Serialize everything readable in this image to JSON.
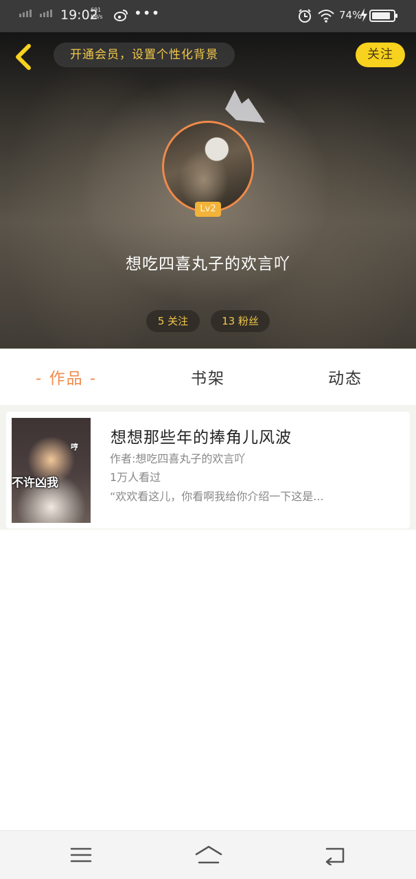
{
  "status_bar": {
    "time": "19:02",
    "net_speed_value": "691",
    "net_speed_unit": "KB/s",
    "more": "•••",
    "battery_percent": "74%"
  },
  "header": {
    "vip_banner": "开通会员，设置个性化背景",
    "follow_button": "关注",
    "level_badge": "Lv2",
    "username": "想吃四喜丸子的欢言吖",
    "following": "5 关注",
    "followers": "13 粉丝"
  },
  "tabs": [
    {
      "label": "- 作品 -",
      "active": true
    },
    {
      "label": "书架",
      "active": false
    },
    {
      "label": "动态",
      "active": false
    }
  ],
  "works": [
    {
      "cover_text_top": "哼",
      "cover_text_bottom": "不许凶我",
      "title": "想想那些年的捧角儿风波",
      "author": "作者:想吃四喜丸子的欢言吖",
      "views": "1万人看过",
      "excerpt": "“欢欢看这儿，你看啊我给你介绍一下这是..."
    }
  ],
  "colors": {
    "accent_orange": "#f08a4a",
    "follow_yellow": "#f7d21e",
    "gold_text": "#f3c94a"
  },
  "icons": {
    "back": "chevron-left-icon",
    "crown": "crown-icon",
    "menu": "menu-icon",
    "home": "home-icon",
    "return": "return-icon"
  }
}
